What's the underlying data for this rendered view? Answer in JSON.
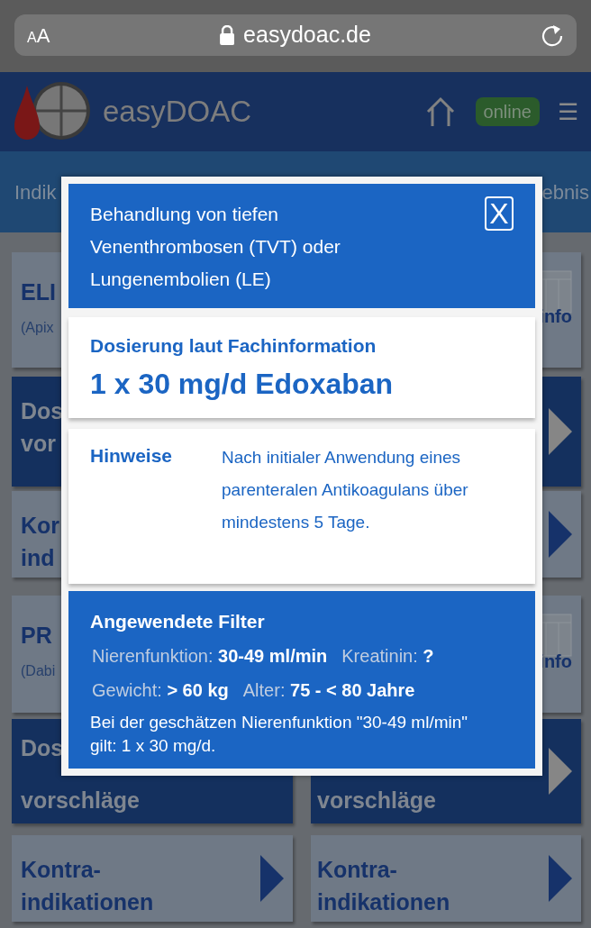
{
  "browser": {
    "text_size_button": "AA",
    "url": "easydoac.de"
  },
  "header": {
    "app_name": "easyDOAC",
    "status_badge": "online",
    "menu_icon": "☰"
  },
  "tab_strip": {
    "left_text": "Indik",
    "right_text": "ebnis"
  },
  "tile_rows": [
    {
      "left": {
        "kind": "drug",
        "title": "ELI",
        "subtitle": "(Apix"
      },
      "right": {
        "kind": "info",
        "label": "info"
      }
    },
    {
      "left": {
        "kind": "dark",
        "lines": [
          "Dos",
          "vor"
        ]
      },
      "right": {
        "kind": "dark",
        "arrow": true
      }
    },
    {
      "left": {
        "kind": "light",
        "lines": [
          "Kor",
          "ind"
        ]
      },
      "right": {
        "kind": "light",
        "arrow": true
      }
    },
    {
      "left": {
        "kind": "drug",
        "title": "PR",
        "subtitle": "(Dabi"
      },
      "right": {
        "kind": "info",
        "label": "info"
      }
    },
    {
      "left": {
        "kind": "dark",
        "lines": [
          "Dos",
          "vorschläge"
        ]
      },
      "right": {
        "kind": "dark",
        "lines": [
          "vorschläge"
        ],
        "arrow": true
      }
    },
    {
      "left": {
        "kind": "light",
        "lines": [
          "Kontra-",
          "indikationen"
        ],
        "arrow": true
      },
      "right": {
        "kind": "light",
        "lines": [
          "Kontra-",
          "indikationen"
        ],
        "arrow": true
      }
    }
  ],
  "modal": {
    "title": "Behandlung von tiefen Venenthrombosen (TVT) oder Lungenembolien (LE)",
    "close": "X",
    "dosage": {
      "label": "Dosierung laut Fachinformation",
      "value": "1 x 30 mg/d Edoxaban"
    },
    "notes": {
      "label": "Hinweise",
      "text": "Nach initialer Anwendung eines parenteralen Antikoagulans über mindestens 5 Tage."
    },
    "filters": {
      "title": "Angewendete Filter",
      "rows": [
        [
          {
            "label": "Nierenfunktion:",
            "value": "30-49 ml/min"
          },
          {
            "label": "Kreatinin:",
            "value": "?"
          }
        ],
        [
          {
            "label": "Gewicht:",
            "value": "> 60 kg"
          },
          {
            "label": "Alter:",
            "value": "75 - < 80 Jahre"
          }
        ]
      ],
      "note": "Bei der geschätzen Nierenfunktion \"30-49 ml/min\" gilt: 1 x 30 mg/d."
    }
  }
}
